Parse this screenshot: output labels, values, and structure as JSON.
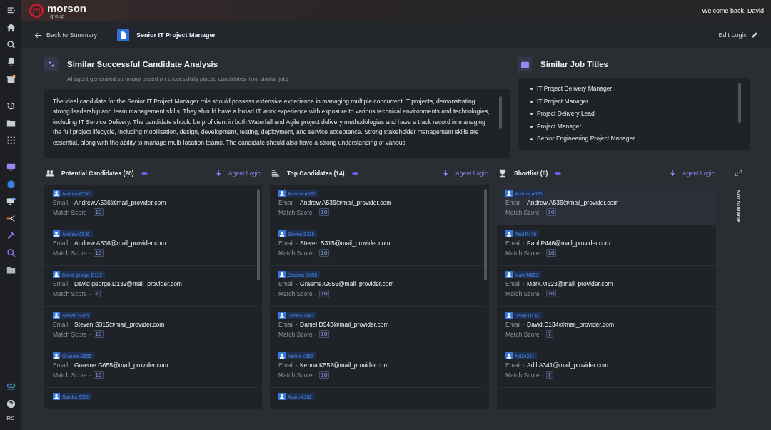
{
  "top_bar": {
    "brand": "morson",
    "brand_sub": "group",
    "greeting": "Welcome back, David"
  },
  "sidebar": {
    "user_initials": "RC"
  },
  "header": {
    "back_link": "Back to Summary",
    "job_title": "Senior IT Project Manager",
    "edit_link": "Edit Logic"
  },
  "analysis": {
    "title": "Similar Successful Candidate Analysis",
    "subtitle": "AI agent generated summary based on successfully placed candidates from similar jobs",
    "summary": "The ideal candidate for the Senior IT Project Manager role should possess extensive experience in managing multiple concurrent IT projects, demonstrating strong leadership and team management skills. They should have a broad IT work experience with exposure to various technical environments and technologies, including IT Service Delivery. The candidate should be proficient in both Waterfall and Agile project delivery methodologies and have a track record in managing the full project lifecycle, including mobilisation, design, development, testing, deployment, and service acceptance. Strong stakeholder management skills are essential, along with the ability to manage multi-location teams. The candidate should also have a strong understanding of various"
  },
  "job_titles": {
    "title": "Similar Job Titles",
    "items": [
      "IT Project Delivery Manager",
      "IT Project Manager",
      "Project Delivery Lead",
      "Project Manager",
      "Senior Engineering Project Manager"
    ]
  },
  "columns": [
    {
      "kind": "potential",
      "title": "Potential Candidates (20)",
      "agent_link": "Agent Logic",
      "cards": [
        {
          "name": "Andrew A536",
          "email_label": "Email",
          "email": "Andrew.A536@mail_provider.com",
          "score_label": "Match Score",
          "score": "10",
          "selected": false
        },
        {
          "name": "Andrew A536",
          "email_label": "Email",
          "email": "Andrew.A536@mail_provider.com",
          "score_label": "Match Score",
          "score": "10",
          "selected": false
        },
        {
          "name": "David george D132",
          "email_label": "Email",
          "email": "David george.D132@mail_provider.com",
          "score_label": "Match Score",
          "score": "7",
          "selected": false
        },
        {
          "name": "Steven S315",
          "email_label": "Email",
          "email": "Steven.S315@mail_provider.com",
          "score_label": "Match Score",
          "score": "10",
          "selected": false
        },
        {
          "name": "Graeme G655",
          "email_label": "Email",
          "email": "Graeme.G655@mail_provider.com",
          "score_label": "Match Score",
          "score": "10",
          "selected": false
        },
        {
          "name": "Sandra S536",
          "selected": false
        }
      ]
    },
    {
      "kind": "top",
      "title": "Top Candidates (14)",
      "agent_link": "Agent Logic",
      "cards": [
        {
          "name": "Andrew A536",
          "email_label": "Email",
          "email": "Andrew.A536@mail_provider.com",
          "score_label": "Match Score",
          "score": "10",
          "selected": false
        },
        {
          "name": "Steven S315",
          "email_label": "Email",
          "email": "Steven.S315@mail_provider.com",
          "score_label": "Match Score",
          "score": "10",
          "selected": false
        },
        {
          "name": "Graeme G655",
          "email_label": "Email",
          "email": "Graeme.G655@mail_provider.com",
          "score_label": "Match Score",
          "score": "10",
          "selected": false
        },
        {
          "name": "Daniel D543",
          "email_label": "Email",
          "email": "Daniel.D543@mail_provider.com",
          "score_label": "Match Score",
          "score": "10",
          "selected": false
        },
        {
          "name": "Kenna K552",
          "email_label": "Email",
          "email": "Kenna.K552@mail_provider.com",
          "score_label": "Match Score",
          "score": "10",
          "selected": false
        },
        {
          "name": "Adam A352",
          "selected": false
        }
      ]
    },
    {
      "kind": "shortlist",
      "title": "Shortlist (5)",
      "agent_link": "Agent Logic",
      "cards": [
        {
          "name": "Andrew A536",
          "email_label": "Email",
          "email": "Andrew.A536@mail_provider.com",
          "score_label": "Match Score",
          "score": "10",
          "selected": true
        },
        {
          "name": "Paul P446",
          "email_label": "Email",
          "email": "Paul.P446@mail_provider.com",
          "score_label": "Match Score",
          "score": "10",
          "selected": false
        },
        {
          "name": "Mark M623",
          "email_label": "Email",
          "email": "Mark.M623@mail_provider.com",
          "score_label": "Match Score",
          "score": "10",
          "selected": false
        },
        {
          "name": "David D134",
          "email_label": "Email",
          "email": "David.D134@mail_provider.com",
          "score_label": "Match Score",
          "score": "7",
          "selected": false
        },
        {
          "name": "Adil A341",
          "email_label": "Email",
          "email": "Adil.A341@mail_provider.com",
          "score_label": "Match Score",
          "score": "7",
          "selected": false
        }
      ]
    }
  ],
  "not_suitable": {
    "label": "Not Suitable"
  },
  "card_separator": "·"
}
